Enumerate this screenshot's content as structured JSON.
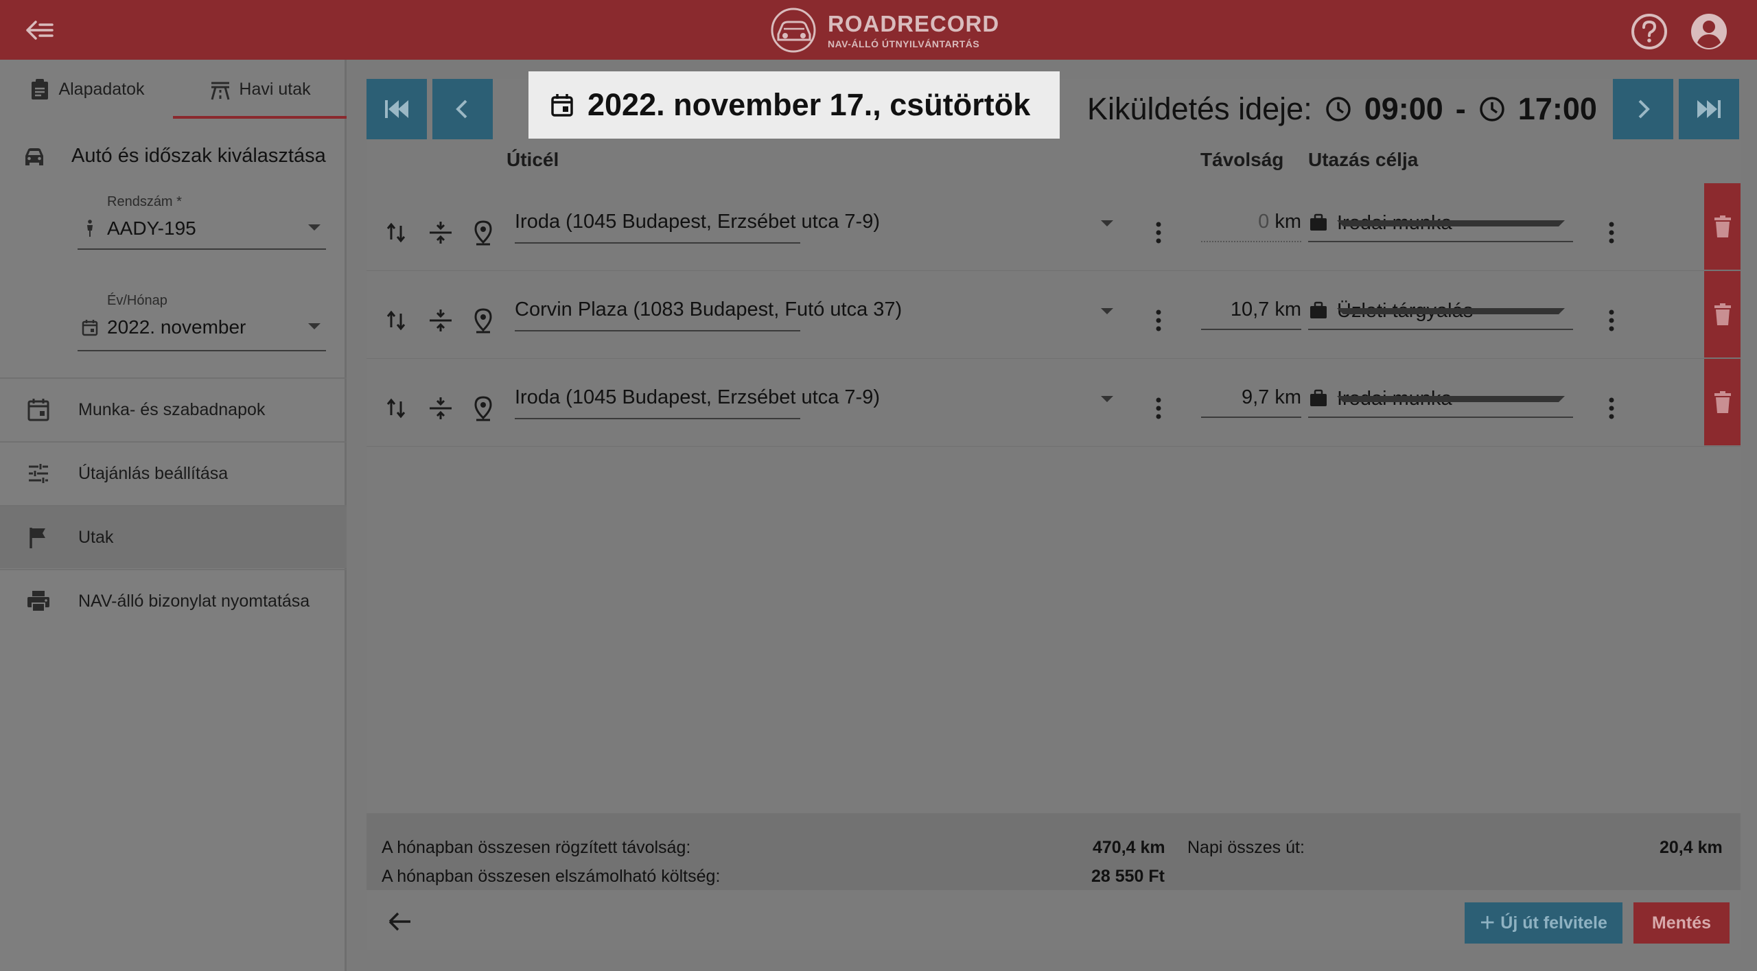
{
  "header": {
    "brand": "ROADRECORD",
    "tagline": "NAV-ÁLLÓ ÚTNYILVÁNTARTÁS",
    "icons": {
      "back": "arrow-left-icon",
      "help": "help-circle-icon",
      "account": "account-circle-icon"
    }
  },
  "sidebar": {
    "tabs": [
      {
        "label": "Alapadatok",
        "icon": "clipboard-icon"
      },
      {
        "label": "Havi utak",
        "icon": "road-icon",
        "active": true
      }
    ],
    "section_title": "Autó és időszak kiválasztása",
    "plate": {
      "label": "Rendszám *",
      "value": "AADY-195"
    },
    "month": {
      "label": "Év/Hónap",
      "value": "2022. november"
    },
    "menu": [
      {
        "label": "Munka- és szabadnapok",
        "icon": "calendar-icon"
      },
      {
        "label": "Útajánlás beállítása",
        "icon": "tune-icon"
      },
      {
        "label": "Utak",
        "icon": "flag-icon",
        "active": true
      },
      {
        "label": "NAV-álló bizonylat nyomtatása",
        "icon": "printer-icon"
      }
    ]
  },
  "daybar": {
    "date": "2022. november 17., csütörtök",
    "duty_label": "Kiküldetés ideje:",
    "start": "09:00",
    "separator": "-",
    "end": "17:00"
  },
  "columns": {
    "destination": "Úticél",
    "distance": "Távolság",
    "purpose": "Utazás célja"
  },
  "trips": [
    {
      "destination": "Iroda (1045 Budapest, Erzsébet utca 7-9)",
      "distance": "0",
      "unit": "km",
      "purpose": "Irodai munka"
    },
    {
      "destination": "Corvin Plaza (1083 Budapest, Futó utca 37)",
      "distance": "10,7",
      "unit": "km",
      "purpose": "Üzleti tárgyalás"
    },
    {
      "destination": "Iroda (1045 Budapest, Erzsébet utca 7-9)",
      "distance": "9,7",
      "unit": "km",
      "purpose": "Irodai munka"
    }
  ],
  "summary": {
    "total_distance_label": "A hónapban összesen rögzített távolság:",
    "total_distance": "470,4 km",
    "total_cost_label": "A hónapban összesen elszámolható költség:",
    "total_cost": "28 550 Ft",
    "daily_label": "Napi összes út:",
    "daily_total": "20,4 km"
  },
  "footer": {
    "new_trip": "Új út felvitele",
    "save": "Mentés"
  },
  "colors": {
    "brand_red": "#8a2a2e",
    "nav_blue": "#2c5f75",
    "highlight": "#ececec"
  }
}
